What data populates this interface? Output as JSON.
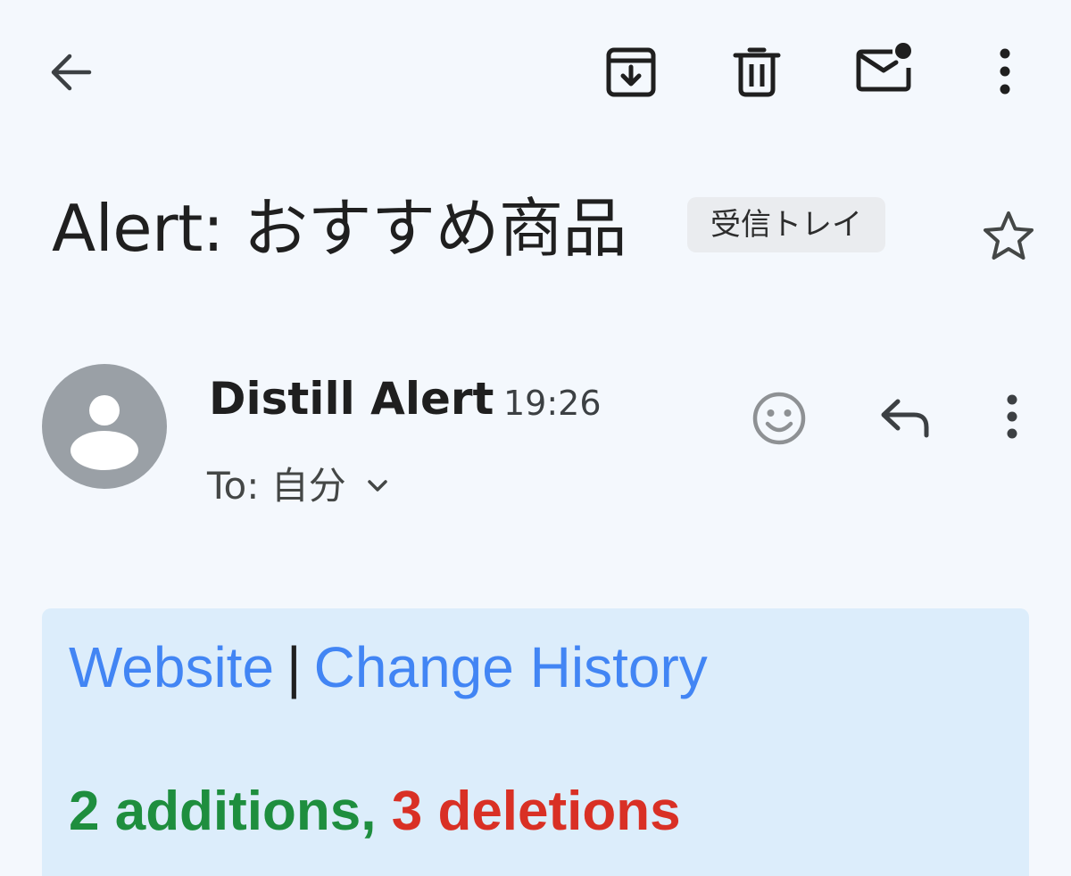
{
  "toolbar": {
    "back_icon": "arrow-back-icon",
    "archive_icon": "archive-icon",
    "delete_icon": "trash-icon",
    "mark_unread_icon": "mail-unread-icon",
    "more_icon": "more-vert-icon"
  },
  "email": {
    "subject": "Alert: おすすめ商品",
    "label": "受信トレイ",
    "star_icon": "star-outline-icon",
    "sender": {
      "name": "Distill Alert",
      "time": "19:26",
      "recipient": "To: 自分",
      "avatar_icon": "person-avatar-icon",
      "avatar_color": "#9aa0a6"
    },
    "actions": {
      "emoji_icon": "emoji-reaction-icon",
      "reply_icon": "reply-icon",
      "more_icon": "more-vert-icon"
    }
  },
  "alert_body": {
    "website_link": "Website",
    "separator": "|",
    "history_link": "Change History",
    "additions": "2 additions",
    "comma": ",",
    "deletions": "3 deletions",
    "card_bg": "#dcedfb",
    "link_color": "#4285f4",
    "additions_color": "#1e8e3e",
    "deletions_color": "#d93025"
  }
}
